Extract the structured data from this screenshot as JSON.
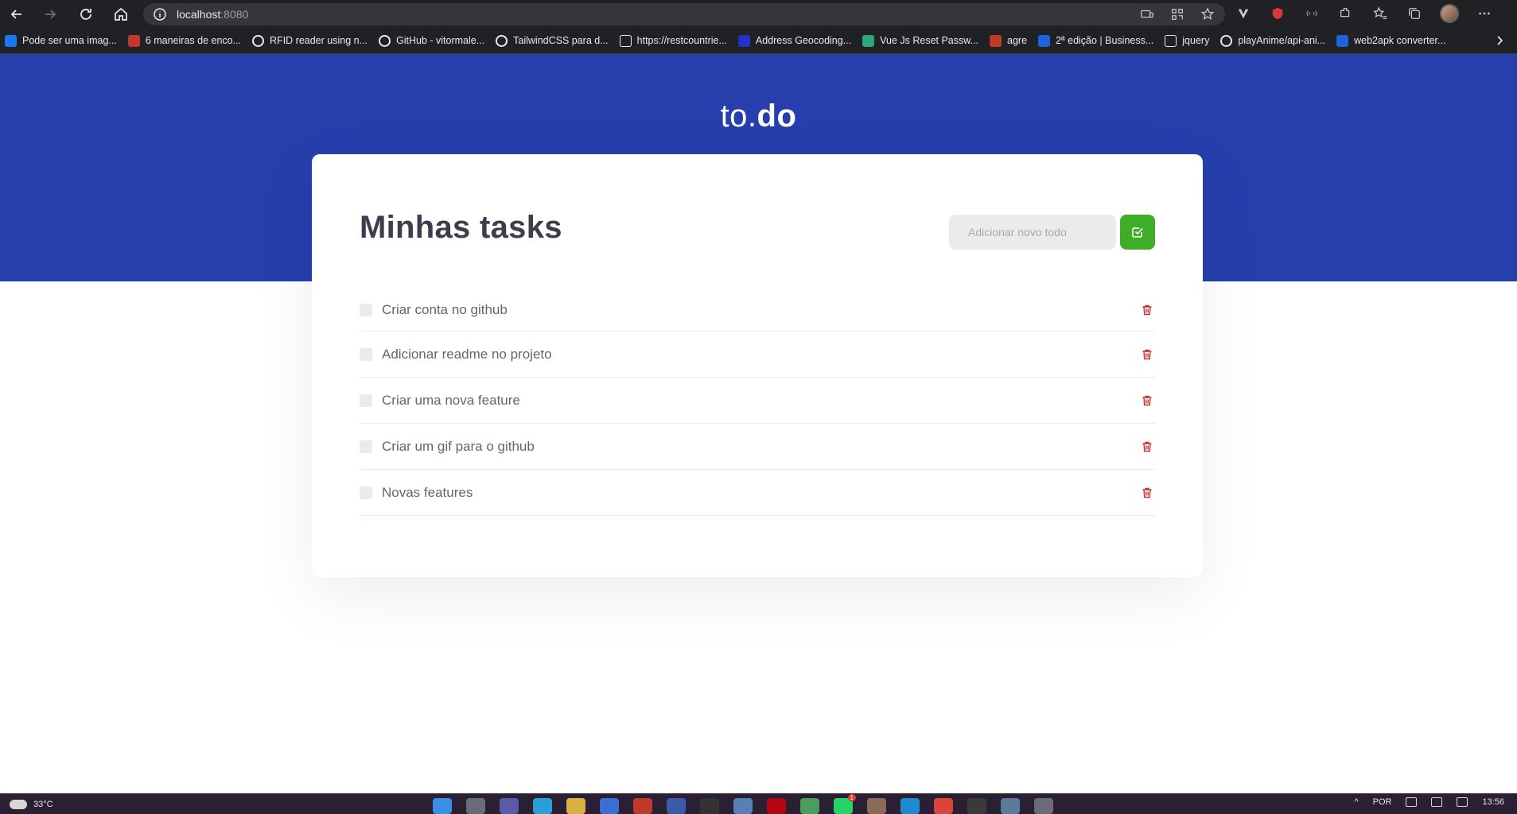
{
  "browser": {
    "url_host": "localhost",
    "url_port": ":8080",
    "bookmarks": [
      {
        "label": "Pode ser uma imag...",
        "icon": "facebook-icon",
        "color": "#1877f2"
      },
      {
        "label": "6 maneiras de enco...",
        "icon": "site-icon",
        "color": "#c0392b"
      },
      {
        "label": "RFID reader using n...",
        "icon": "github-icon",
        "color": "#e8eaed"
      },
      {
        "label": "GitHub - vitormale...",
        "icon": "github-icon",
        "color": "#e8eaed"
      },
      {
        "label": "TailwindCSS para d...",
        "icon": "github-icon",
        "color": "#e8eaed"
      },
      {
        "label": "https://restcountrie...",
        "icon": "page-icon",
        "color": "#e8eaed"
      },
      {
        "label": "Address Geocoding...",
        "icon": "js-icon",
        "color": "#2430c8"
      },
      {
        "label": "Vue Js Reset Passw...",
        "icon": "vue-icon",
        "color": "#2ea57b"
      },
      {
        "label": "agre",
        "icon": "agre-icon",
        "color": "#c0392b"
      },
      {
        "label": "2ª edição | Business...",
        "icon": "book-icon",
        "color": "#1e63d8"
      },
      {
        "label": "jquery",
        "icon": "page-icon",
        "color": "#e8eaed"
      },
      {
        "label": "playAnime/api-ani...",
        "icon": "github-icon",
        "color": "#e8eaed"
      },
      {
        "label": "web2apk converter...",
        "icon": "web2apk-icon",
        "color": "#1e63d8"
      }
    ]
  },
  "app": {
    "brand_prefix": "to.",
    "brand_suffix": "do",
    "title": "Minhas tasks",
    "input_placeholder": "Adicionar novo todo",
    "colors": {
      "header_bg": "#273fad",
      "add_button": "#3fad27",
      "delete_icon": "#c53030",
      "title_text": "#3d3d4d",
      "item_text": "#666666"
    },
    "todos": [
      {
        "title": "Criar conta no github",
        "done": false
      },
      {
        "title": "Adicionar readme no projeto",
        "done": false
      },
      {
        "title": "Criar uma nova feature",
        "done": false
      },
      {
        "title": "Criar um gif para o github",
        "done": false
      },
      {
        "title": "Novas features",
        "done": false
      }
    ]
  },
  "taskbar": {
    "temperature": "33°C",
    "language": "POR",
    "time": "13:56",
    "notification_badge": "1"
  }
}
